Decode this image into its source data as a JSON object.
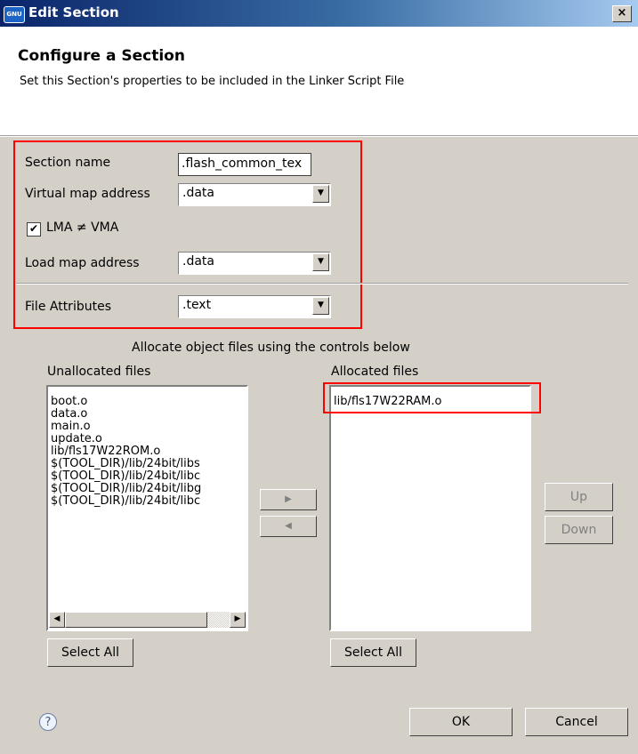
{
  "window": {
    "title": "Edit Section",
    "app_icon_text": "GNU",
    "close_glyph": "×"
  },
  "banner": {
    "title": "Configure a Section",
    "subtitle": "Set this Section's properties to be included in the Linker Script File"
  },
  "form": {
    "section_name_label": "Section name",
    "section_name_value": ".flash_common_tex",
    "vma_label": "Virtual map address",
    "vma_value": ".data",
    "lma_checkbox_label": "LMA ≠ VMA",
    "lma_checked": true,
    "lma_label": "Load map address",
    "lma_value": ".data",
    "file_attr_label": "File Attributes",
    "file_attr_value": ".text"
  },
  "allocation": {
    "instruction": "Allocate object files using the controls below",
    "unallocated_label": "Unallocated files",
    "unallocated_items": [
      "boot.o",
      "data.o",
      "main.o",
      "update.o",
      "lib/fls17W22ROM.o",
      "$(TOOL_DIR)/lib/24bit/libs",
      "$(TOOL_DIR)/lib/24bit/libc",
      "$(TOOL_DIR)/lib/24bit/libg",
      "$(TOOL_DIR)/lib/24bit/libc"
    ],
    "allocated_label": "Allocated files",
    "allocated_items": [
      "lib/fls17W22RAM.o"
    ],
    "move_right_glyph": "▶",
    "move_left_glyph": "◀",
    "up_label": "Up",
    "down_label": "Down",
    "select_all_label": "Select All"
  },
  "footer": {
    "help_glyph": "?",
    "ok_label": "OK",
    "cancel_label": "Cancel"
  }
}
